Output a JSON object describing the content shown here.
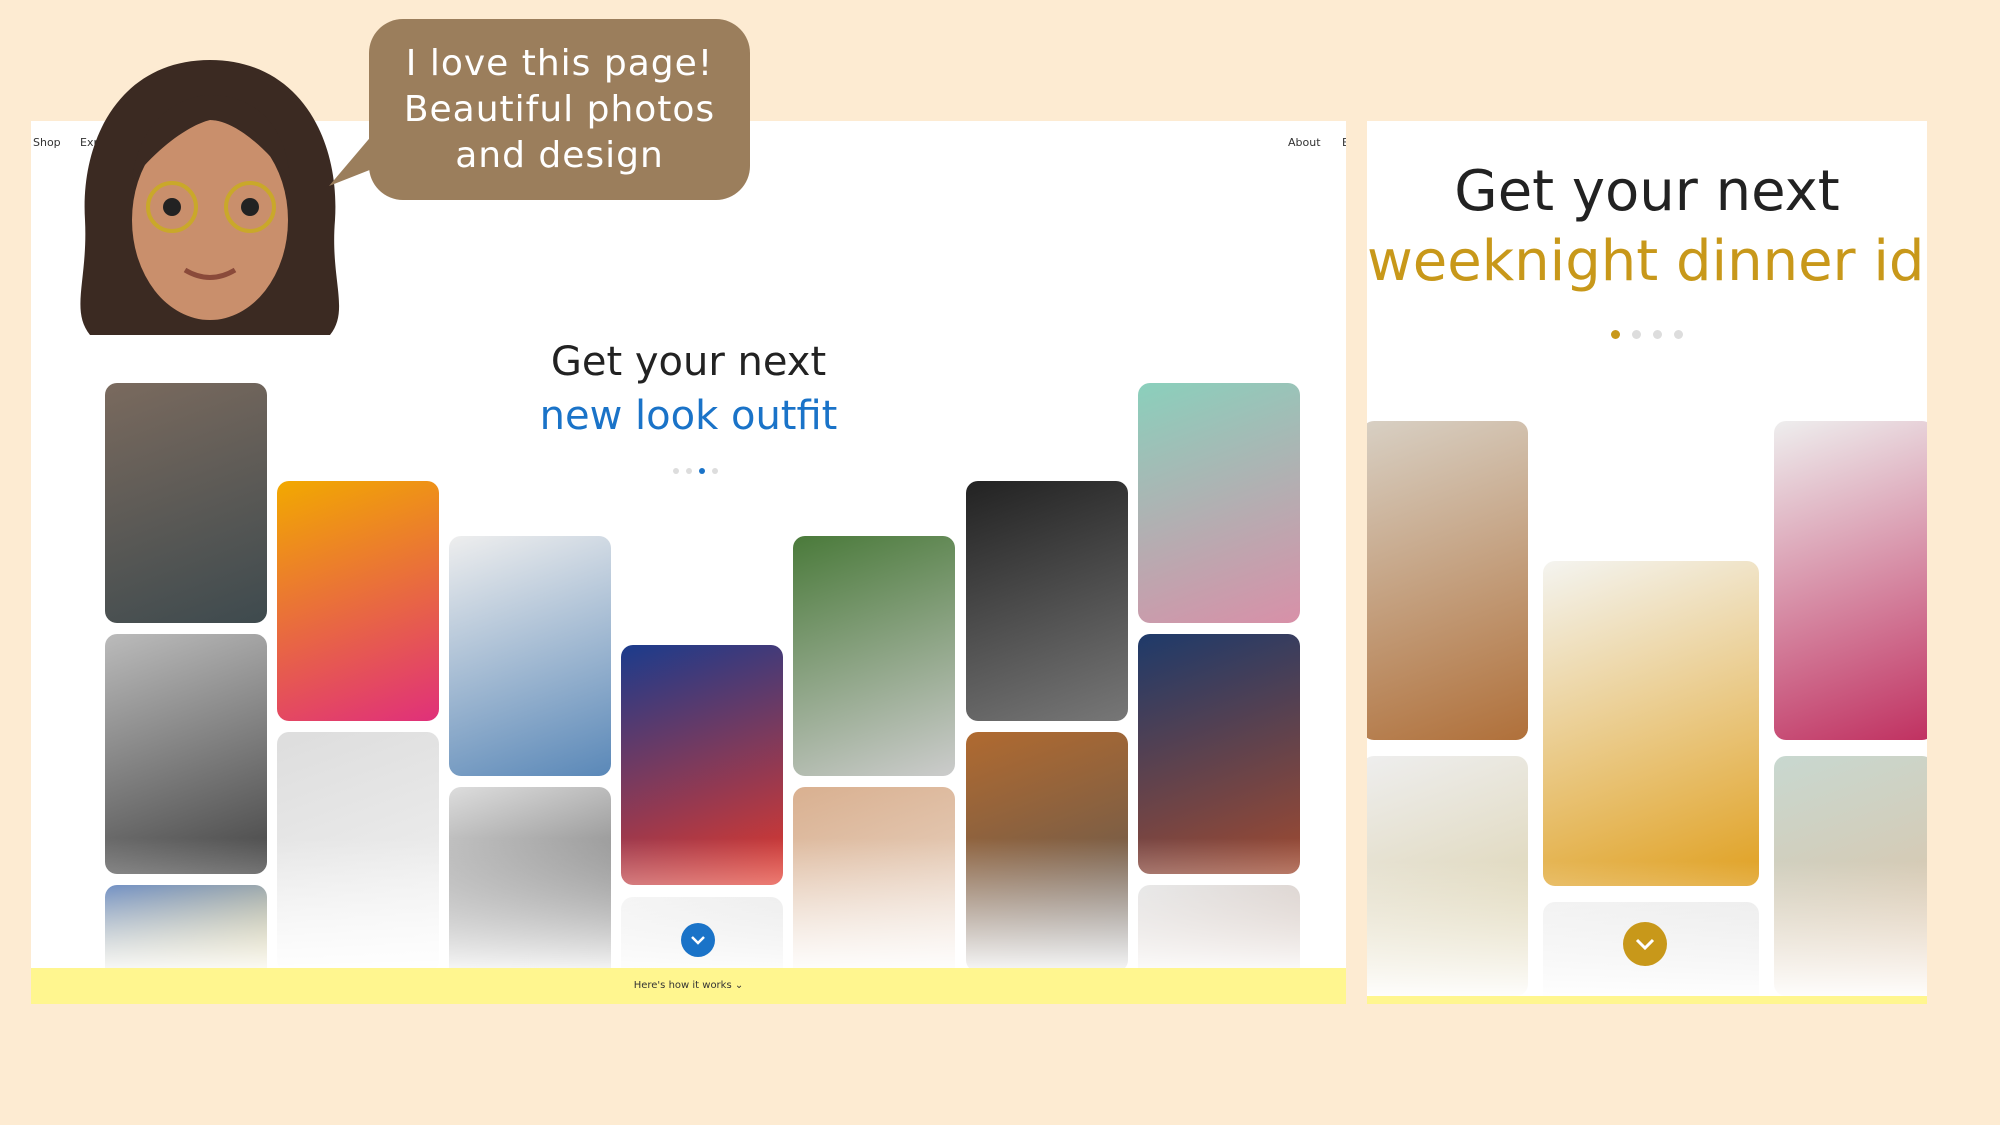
{
  "left_page": {
    "nav": {
      "shop": "Shop",
      "explore": "Explore",
      "about": "About",
      "business": "B"
    },
    "headline": "Get your next",
    "highlight": "new look outfit",
    "highlight_color": "#1a73c8",
    "carousel": {
      "total": 4,
      "active": 3
    },
    "footer_link": "Here's how it works",
    "chevron_icon": "chevron-down-icon"
  },
  "right_page": {
    "headline": "Get your next",
    "highlight": "weeknight dinner idea",
    "highlight_color": "#c8981a",
    "carousel": {
      "total": 4,
      "active": 1
    }
  },
  "speech_bubble": {
    "lines": [
      "I love this page!",
      "Beautiful photos",
      "and design"
    ]
  },
  "colors": {
    "background": "#fdebd2",
    "footer_bar": "#fff68f",
    "bubble": "#9b7e5c"
  }
}
